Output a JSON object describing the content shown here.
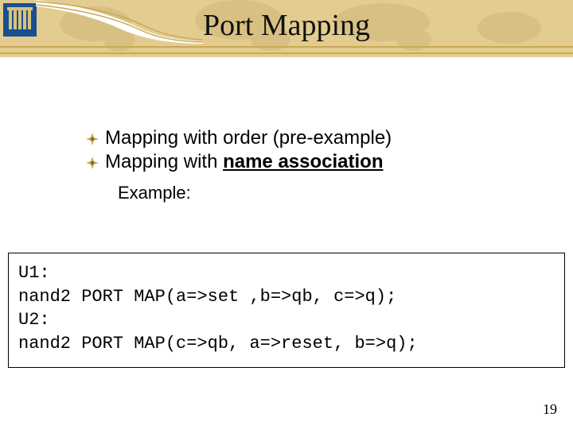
{
  "slide": {
    "title": "Port Mapping",
    "bullets": [
      {
        "text_plain": "Mapping with order (pre-example)",
        "text_html": "Mapping with order (pre-example)"
      },
      {
        "text_plain": "Mapping with name association",
        "text_html": "Mapping with <span class=\"bold underline\">name association</span>"
      }
    ],
    "example_label": "Example:",
    "code": "U1:\nnand2 PORT MAP(a=>set ,b=>qb, c=>q);\nU2:\nnand2 PORT MAP(c=>qb, a=>reset, b=>q);",
    "page_number": "19"
  },
  "icons": {
    "bullet": "compass-bullet-icon",
    "logo": "institution-logo-icon"
  },
  "colors": {
    "band": "#e3cc8f",
    "gold_line": "#c9a956",
    "logo_bg": "#1a4f8f"
  }
}
